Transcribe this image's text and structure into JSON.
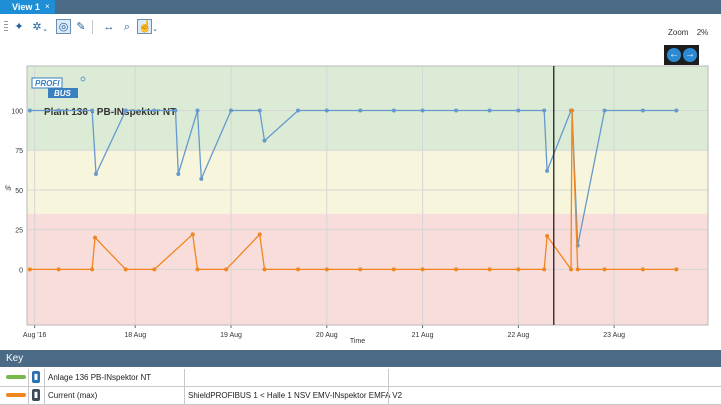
{
  "tabs": [
    {
      "label": "View 1",
      "close": "×"
    }
  ],
  "toolbar": {
    "icons": [
      "compass-icon",
      "settings-icon",
      "view-toggle-icon",
      "pen-icon",
      "fit-width-icon",
      "magnifier-icon",
      "pan-tool-icon"
    ],
    "zoom_label": "Zoom",
    "zoom_value": "2%"
  },
  "chart_data": {
    "type": "line",
    "title": "Plant 136 - PB-INspektor NT",
    "logo_text": [
      "PROFI",
      "BUS"
    ],
    "xlabel": "Time",
    "ylabel": "%",
    "ylim": [
      -35,
      128
    ],
    "yticks": [
      0,
      25,
      50,
      75,
      100
    ],
    "xticks": [
      "Aug '16",
      "18 Aug",
      "19 Aug",
      "20 Aug",
      "21 Aug",
      "22 Aug",
      "23 Aug"
    ],
    "xtick_days": [
      16.95,
      18.0,
      19.0,
      20.0,
      21.0,
      22.0,
      23.0
    ],
    "xlim": [
      16.87,
      23.98
    ],
    "cursor_day": 22.37,
    "grid": true,
    "bands": [
      {
        "from": 75,
        "to": 128,
        "color": "#dcebd6"
      },
      {
        "from": 35,
        "to": 75,
        "color": "#f7f5dc"
      },
      {
        "from": -35,
        "to": 35,
        "color": "#f8dddb"
      }
    ],
    "series": [
      {
        "color": "#6699cc",
        "x": [
          16.9,
          17.2,
          17.55,
          17.59,
          17.9,
          18.2,
          18.42,
          18.45,
          18.65,
          18.69,
          19.0,
          19.3,
          19.35,
          19.7,
          20.0,
          20.35,
          20.7,
          21.0,
          21.35,
          21.7,
          22.0,
          22.27,
          22.3,
          22.55,
          22.56,
          22.62,
          22.9,
          23.3,
          23.65
        ],
        "y": [
          100,
          100,
          100,
          60,
          100,
          100,
          100,
          60,
          100,
          57,
          100,
          100,
          81,
          100,
          100,
          100,
          100,
          100,
          100,
          100,
          100,
          100,
          62,
          100,
          100,
          15,
          100,
          100,
          100
        ]
      },
      {
        "color": "#f0861f",
        "x": [
          16.9,
          17.2,
          17.55,
          17.58,
          17.9,
          18.2,
          18.6,
          18.65,
          18.95,
          19.3,
          19.35,
          19.7,
          20.0,
          20.35,
          20.7,
          21.0,
          21.35,
          21.7,
          22.0,
          22.27,
          22.3,
          22.55,
          22.56,
          22.62,
          22.9,
          23.3,
          23.65
        ],
        "y": [
          0,
          0,
          0,
          20,
          0,
          0,
          22,
          0,
          0,
          22,
          0,
          0,
          0,
          0,
          0,
          0,
          0,
          0,
          0,
          0,
          21,
          0,
          100,
          0,
          0,
          0,
          0
        ]
      }
    ]
  },
  "key": {
    "title": "Key",
    "rows": [
      {
        "color": "#78b84a",
        "name": "Anlage 136 PB-INspektor NT",
        "device": ""
      },
      {
        "color": "#f0861f",
        "name": "Current (max)",
        "device": "ShieldPROFIBUS 1 < Halle 1 NSV EMV-INspektor EMFA V2"
      }
    ]
  }
}
